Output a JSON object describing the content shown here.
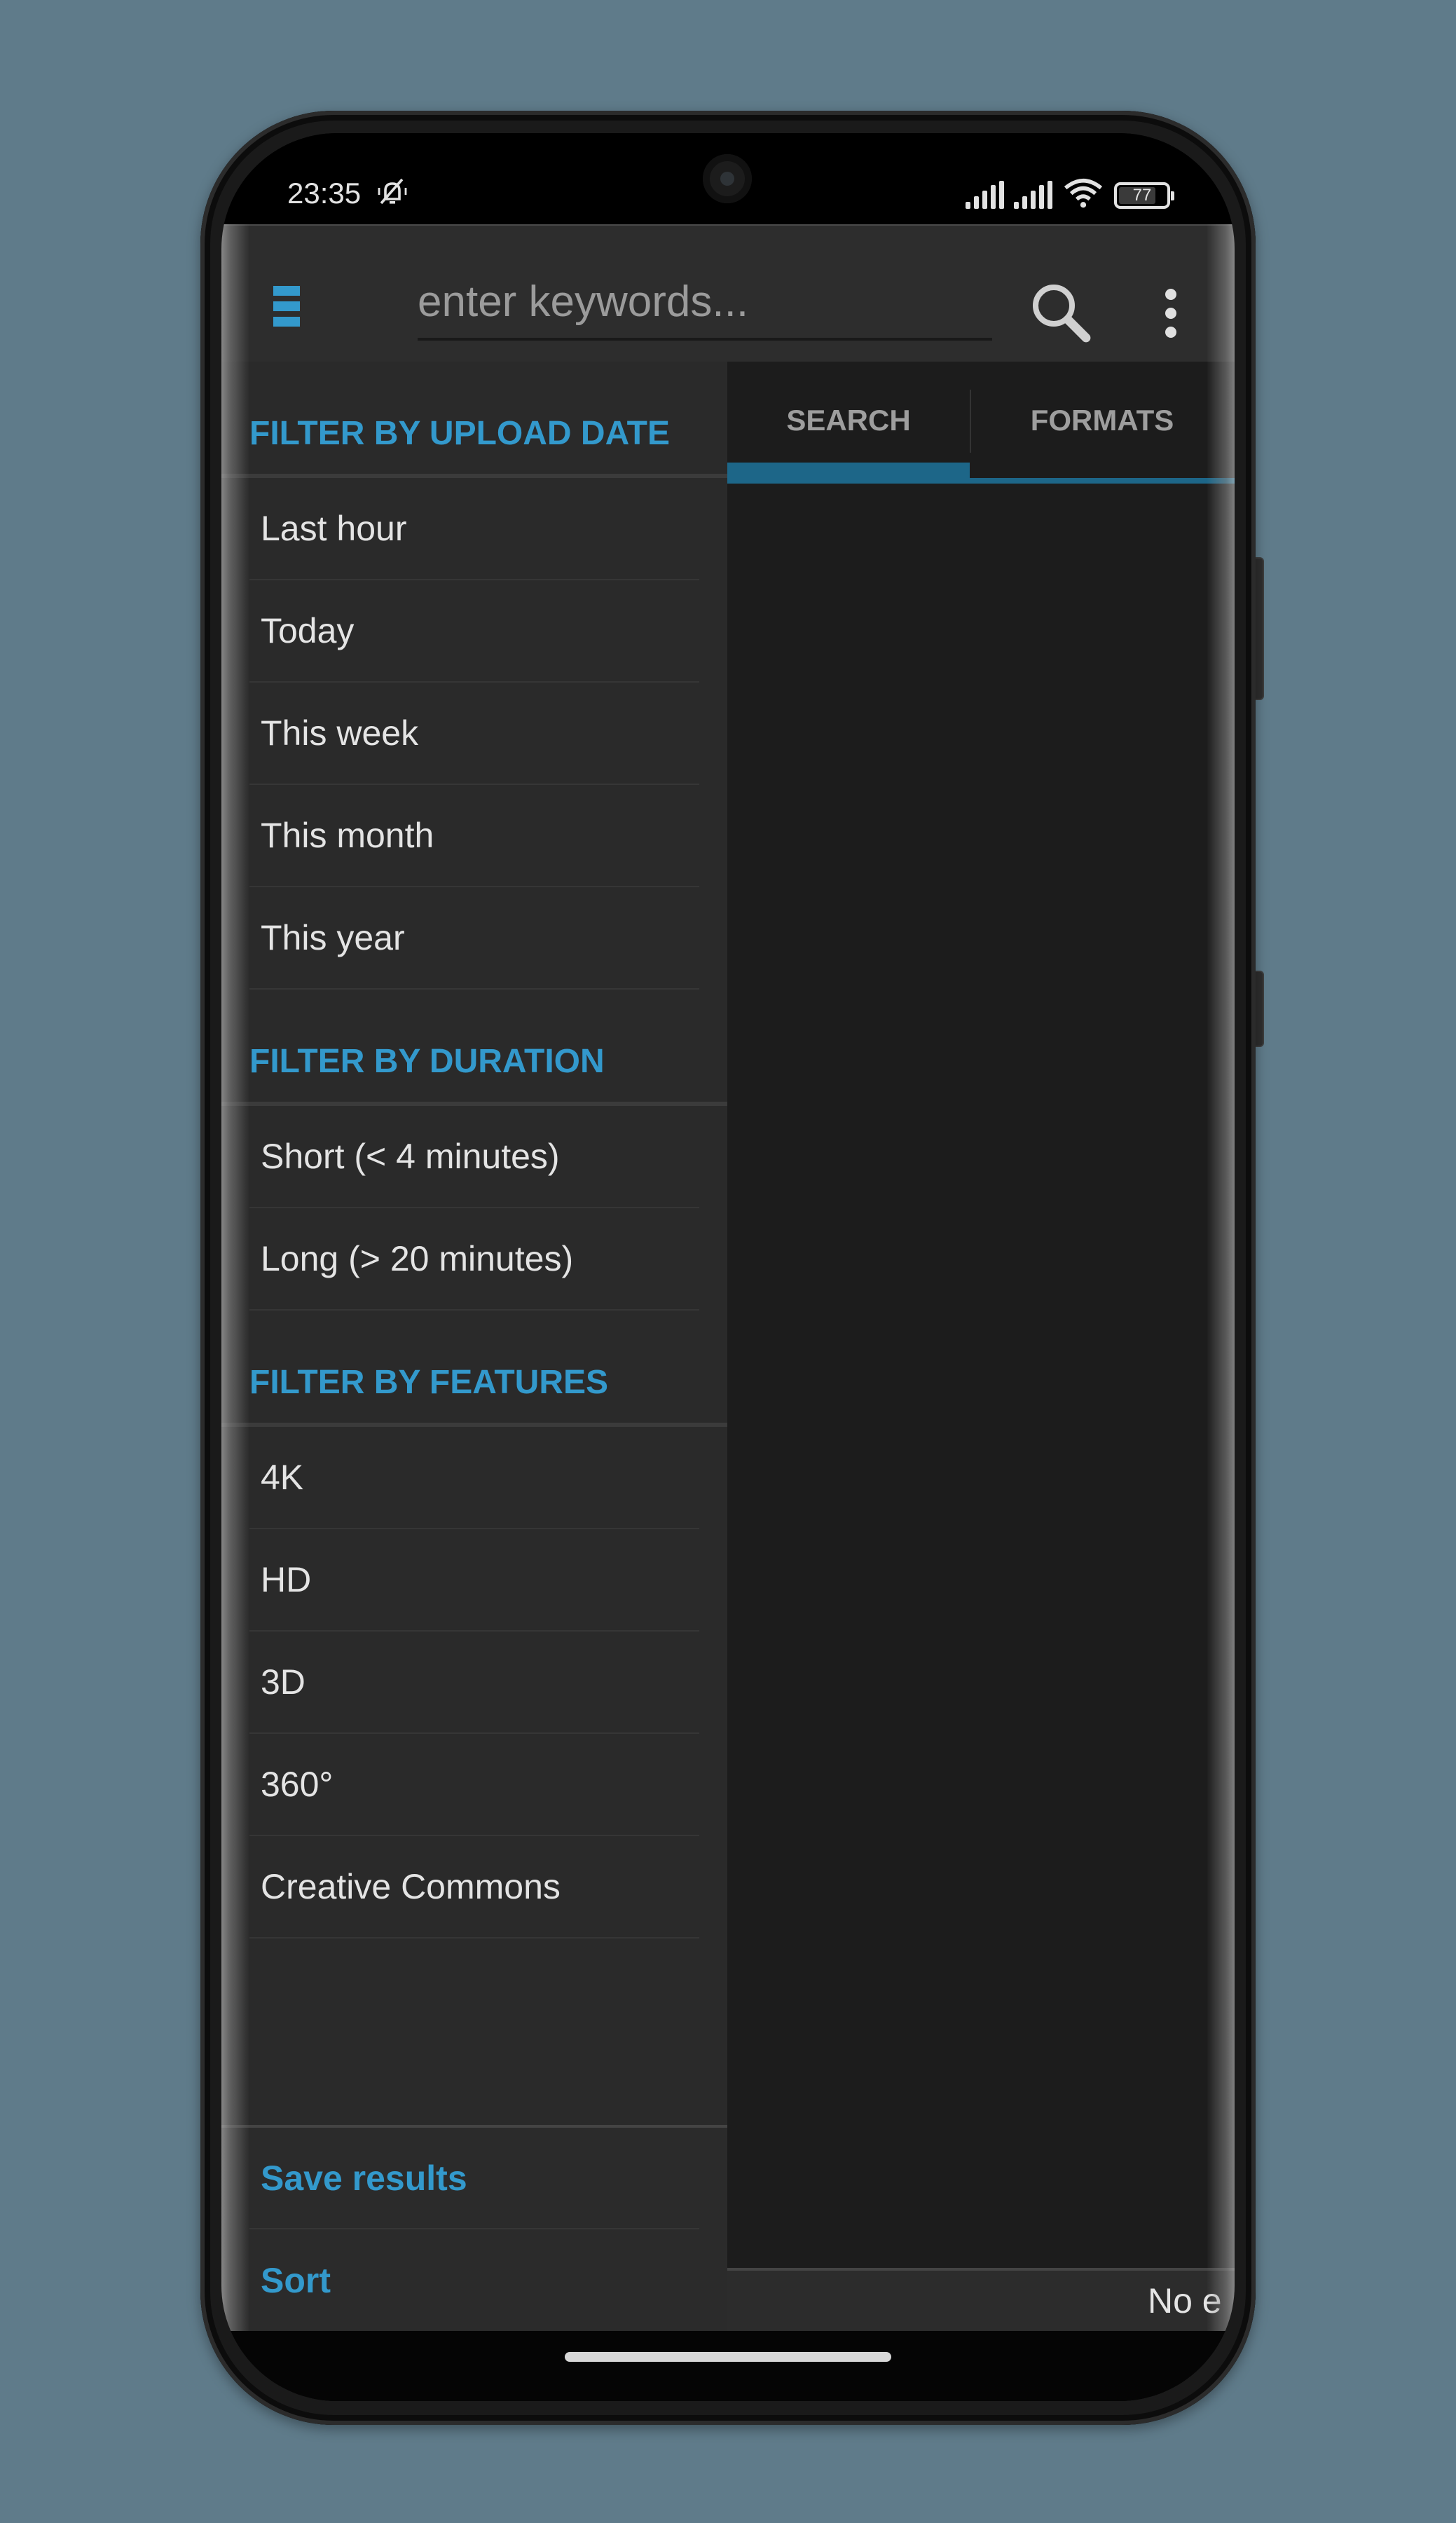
{
  "status_bar": {
    "time": "23:35",
    "icons": [
      "bell-off-icon",
      "signal-icon",
      "signal-icon",
      "wifi-icon",
      "battery-icon"
    ],
    "battery_level": "77"
  },
  "app_bar": {
    "menu_icon": "menu-icon",
    "search_placeholder": "enter keywords...",
    "search_value": "",
    "search_icon": "search-icon",
    "overflow_icon": "more-vert-icon"
  },
  "drawer": {
    "sections": [
      {
        "title": "FILTER BY UPLOAD DATE",
        "items": [
          "Last hour",
          "Today",
          "This week",
          "This month",
          "This year"
        ]
      },
      {
        "title": "FILTER BY DURATION",
        "items": [
          "Short (< 4 minutes)",
          "Long (> 20 minutes)"
        ]
      },
      {
        "title": "FILTER BY FEATURES",
        "items": [
          "4K",
          "HD",
          "3D",
          "360°",
          "Creative Commons"
        ]
      }
    ],
    "actions": [
      "Save results",
      "Sort"
    ]
  },
  "main": {
    "tabs": [
      {
        "label": "SEARCH",
        "active": true
      },
      {
        "label": "FORMATS",
        "active": false
      }
    ],
    "footer_text": "No e"
  },
  "colors": {
    "accent": "#3399cc",
    "tab_indicator": "#1d6688",
    "background": "#5f7b8a"
  }
}
